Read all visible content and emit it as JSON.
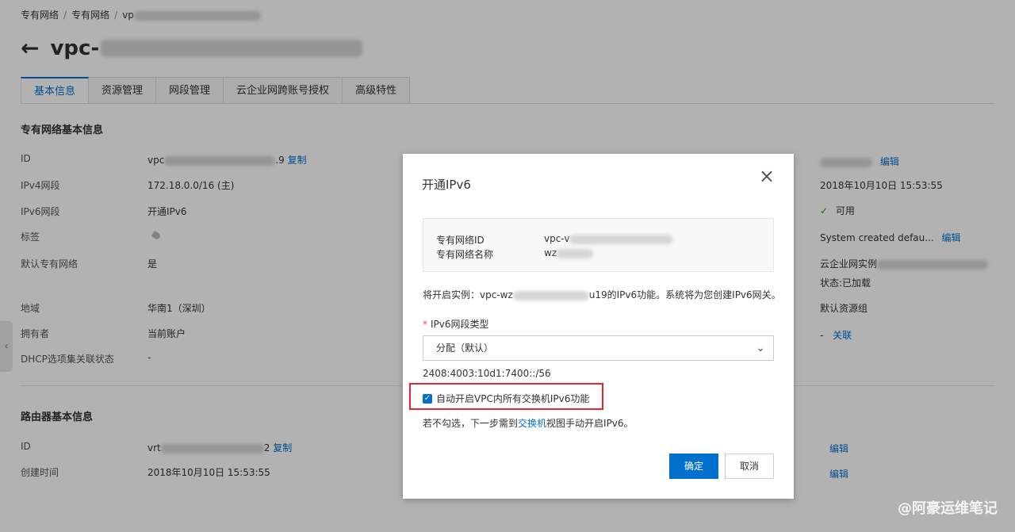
{
  "breadcrumb": [
    "专有网络",
    "专有网络",
    "vp"
  ],
  "page_title": "vpc-",
  "tabs": [
    "基本信息",
    "资源管理",
    "网段管理",
    "云企业网跨账号授权",
    "高级特性"
  ],
  "vpc_section": {
    "title": "专有网络基本信息",
    "rows": [
      {
        "key": "ID",
        "value": "vpc",
        "tail": ".9",
        "link": "复制"
      },
      {
        "key": "IPv4网段",
        "value": "172.18.0.0/16 (主)"
      },
      {
        "key": "IPv6网段",
        "link": "开通IPv6"
      },
      {
        "key": "标签"
      },
      {
        "key": "默认专有网络",
        "value": "是"
      },
      {
        "key": "地域",
        "value": "华南1（深圳）"
      },
      {
        "key": "拥有者",
        "value": "当前账户"
      },
      {
        "key": "DHCP选项集关联状态",
        "value": "-"
      }
    ]
  },
  "right_column": {
    "edit": "编辑",
    "created": "2018年10月10日 15:53:55",
    "status": "可用",
    "desc": "System created defau...",
    "cen": "云企业网实例",
    "cen_status": "状态:已加载",
    "resource_group": "默认资源组",
    "dash": "-",
    "associate": "关联"
  },
  "router_section": {
    "title": "路由器基本信息",
    "rows": [
      {
        "key": "ID",
        "value": "vrt",
        "tail": "2",
        "link": "复制"
      },
      {
        "key": "创建时间",
        "value": "2018年10月10日 15:53:55"
      }
    ],
    "edit": "编辑"
  },
  "dialog": {
    "title": "开通IPv6",
    "close": "×",
    "info": [
      {
        "label": "专有网络ID",
        "value": "vpc-v"
      },
      {
        "label": "专有网络名称",
        "value": "wz"
      }
    ],
    "notice_prefix": "将开启实例：vpc-wz",
    "notice_suffix": "u19的IPv6功能。系统将为您创建IPv6网关。",
    "field_label": "IPv6网段类型",
    "field_required": "*",
    "select_value": "分配（默认）",
    "cidr": "2408:4003:10d1:7400::/56",
    "checkbox_label": "自动开启VPC内所有交换机IPv6功能",
    "checkbox_checked": true,
    "hint_prefix": "若不勾选，下一步需到",
    "hint_link": "交换机",
    "hint_suffix": "视图手动开启IPv6。",
    "ok": "确定",
    "cancel": "取消"
  },
  "watermark": "@阿豪运维笔记",
  "colors": {
    "accent": "#0070cc",
    "highlight": "#e0282e",
    "status_ok": "#1aa01a"
  }
}
